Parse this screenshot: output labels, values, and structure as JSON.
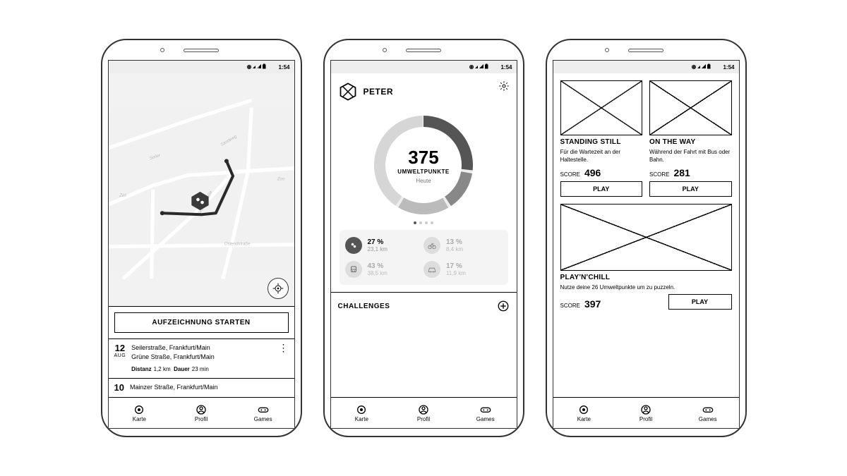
{
  "statusbar": {
    "time": "1:54"
  },
  "tabs": {
    "map": "Karte",
    "profile": "Profil",
    "games": "Games"
  },
  "screen1": {
    "start_button": "AUFZEICHNUNG STARTEN",
    "entries": [
      {
        "day": "12",
        "month": "AUG",
        "line1": "Seilerstraße, Frankfurt/Main",
        "line2": "Grüne Straße, Frankfurt/Main",
        "dist_label": "Distanz",
        "dist": "1,2 km",
        "dur_label": "Dauer",
        "dur": "23 min"
      },
      {
        "day": "10",
        "month": "",
        "line1": "Mainzer Straße, Frankfurt/Main"
      }
    ]
  },
  "screen2": {
    "username": "PETER",
    "center_value": "375",
    "center_label": "UMWELTPUNKTE",
    "center_sub": "Heute",
    "challenges_label": "CHALLENGES",
    "stats": [
      {
        "pct": "27 %",
        "dist": "23,1 km"
      },
      {
        "pct": "13 %",
        "dist": "8,4 km"
      },
      {
        "pct": "43 %",
        "dist": "38,5 km"
      },
      {
        "pct": "17 %",
        "dist": "11,9 km"
      }
    ]
  },
  "screen3": {
    "score_label": "SCORE",
    "play_label": "PLAY",
    "card1": {
      "title": "STANDING STILL",
      "desc": "Für die Wartezeit an der Haltestelle.",
      "score": "496"
    },
    "card2": {
      "title": "ON THE WAY",
      "desc": "Während der Fahrt mit Bus oder Bahn.",
      "score": "281"
    },
    "card3": {
      "title": "PLAY'N'CHILL",
      "desc": "Nutze deine 26 Umweltpunkte um zu puzzeln.",
      "score": "397"
    }
  }
}
